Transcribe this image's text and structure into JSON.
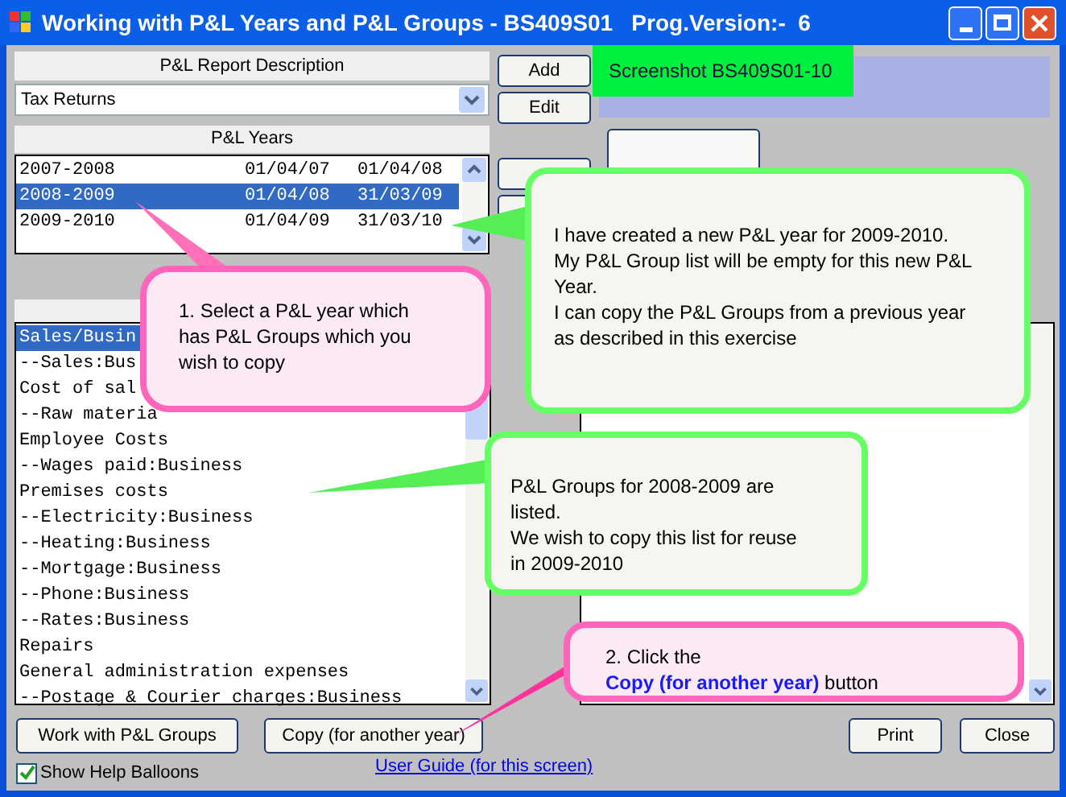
{
  "window": {
    "title": "Working with P&L Years and P&L Groups - BS409S01   Prog.Version:-  6"
  },
  "screenshot_label": "Screenshot BS409S01-10",
  "report_description": {
    "header": "P&L Report Description",
    "value": "Tax Returns"
  },
  "side_buttons": [
    "Add",
    "Edit"
  ],
  "years": {
    "header": "P&L Years",
    "rows": [
      {
        "name": "2007-2008",
        "start": "01/04/07",
        "end": "01/04/08",
        "selected": false
      },
      {
        "name": "2008-2009",
        "start": "01/04/08",
        "end": "31/03/09",
        "selected": true
      },
      {
        "name": "2009-2010",
        "start": "01/04/09",
        "end": "31/03/10",
        "selected": false
      }
    ]
  },
  "groups": [
    {
      "text": "Sales/Busin",
      "selected": true
    },
    {
      "text": "--Sales:Bus",
      "selected": false
    },
    {
      "text": "Cost of sal",
      "selected": false
    },
    {
      "text": "--Raw materia",
      "selected": false
    },
    {
      "text": "Employee Costs",
      "selected": false
    },
    {
      "text": "--Wages paid:Business",
      "selected": false
    },
    {
      "text": "Premises costs",
      "selected": false
    },
    {
      "text": "--Electricity:Business",
      "selected": false
    },
    {
      "text": "--Heating:Business",
      "selected": false
    },
    {
      "text": "--Mortgage:Business",
      "selected": false
    },
    {
      "text": "--Phone:Business",
      "selected": false
    },
    {
      "text": "--Rates:Business",
      "selected": false
    },
    {
      "text": "Repairs",
      "selected": false
    },
    {
      "text": "General administration expenses",
      "selected": false
    },
    {
      "text": "--Postage & Courier charges:Business",
      "selected": false
    }
  ],
  "balloons": [
    {
      "kind": "green",
      "text": "I have created a new P&L year for 2009-2010.\nMy P&L Group list will be empty for this new P&L Year.\nI can copy the P&L Groups from a previous year as described in this exercise"
    },
    {
      "kind": "pink",
      "text": "1. Select a P&L year which has P&L Groups which you wish to copy"
    },
    {
      "kind": "green",
      "text": "P&L Groups for 2008-2009 are listed.\nWe wish to copy this list for reuse in 2009-2010"
    },
    {
      "kind": "pink",
      "text": "2. Click the\n**Copy (for another year)** button"
    }
  ],
  "bottom_buttons": [
    "Work with P&L Groups",
    "Copy (for another year)",
    "Print",
    "Close"
  ],
  "show_help_balloons": {
    "label": "Show Help Balloons",
    "checked": true
  },
  "user_guide_link": "User Guide (for this screen)"
}
